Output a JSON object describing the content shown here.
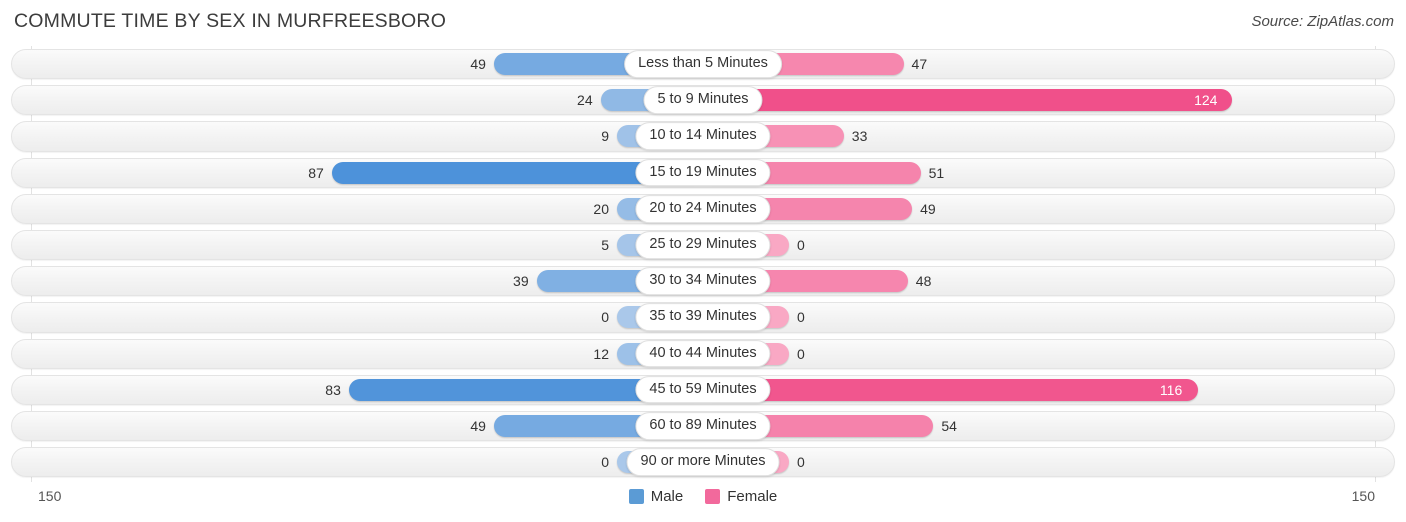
{
  "header": {
    "title": "COMMUTE TIME BY SEX IN MURFREESBORO",
    "source": "Source: ZipAtlas.com"
  },
  "axis": {
    "left_max_label": "150",
    "right_max_label": "150",
    "max": 150
  },
  "legend": [
    {
      "label": "Male",
      "color": "#5b9bd5"
    },
    {
      "label": "Female",
      "color": "#f2699c"
    }
  ],
  "colors": {
    "male_dark": "#4a90d9",
    "male_light": "#aac8ea",
    "female_dark": "#f0508a",
    "female_light": "#f9a8c4",
    "track": "#f3f3f3",
    "pill": "#ffffff"
  },
  "chart_data": {
    "type": "bar",
    "title": "COMMUTE TIME BY SEX IN MURFREESBORO",
    "subtitle": "Source: ZipAtlas.com",
    "orientation": "horizontal-diverging",
    "xlabel": "",
    "ylabel": "",
    "xlim": [
      -150,
      150
    ],
    "axis_max": 150,
    "grid": false,
    "legend_position": "bottom-center",
    "categories": [
      "Less than 5 Minutes",
      "5 to 9 Minutes",
      "10 to 14 Minutes",
      "15 to 19 Minutes",
      "20 to 24 Minutes",
      "25 to 29 Minutes",
      "30 to 34 Minutes",
      "35 to 39 Minutes",
      "40 to 44 Minutes",
      "45 to 59 Minutes",
      "60 to 89 Minutes",
      "90 or more Minutes"
    ],
    "series": [
      {
        "name": "Male",
        "side": "left",
        "values": [
          49,
          24,
          9,
          87,
          20,
          5,
          39,
          0,
          12,
          83,
          49,
          0
        ]
      },
      {
        "name": "Female",
        "side": "right",
        "values": [
          47,
          124,
          33,
          51,
          49,
          0,
          48,
          0,
          0,
          116,
          54,
          0
        ]
      }
    ]
  }
}
